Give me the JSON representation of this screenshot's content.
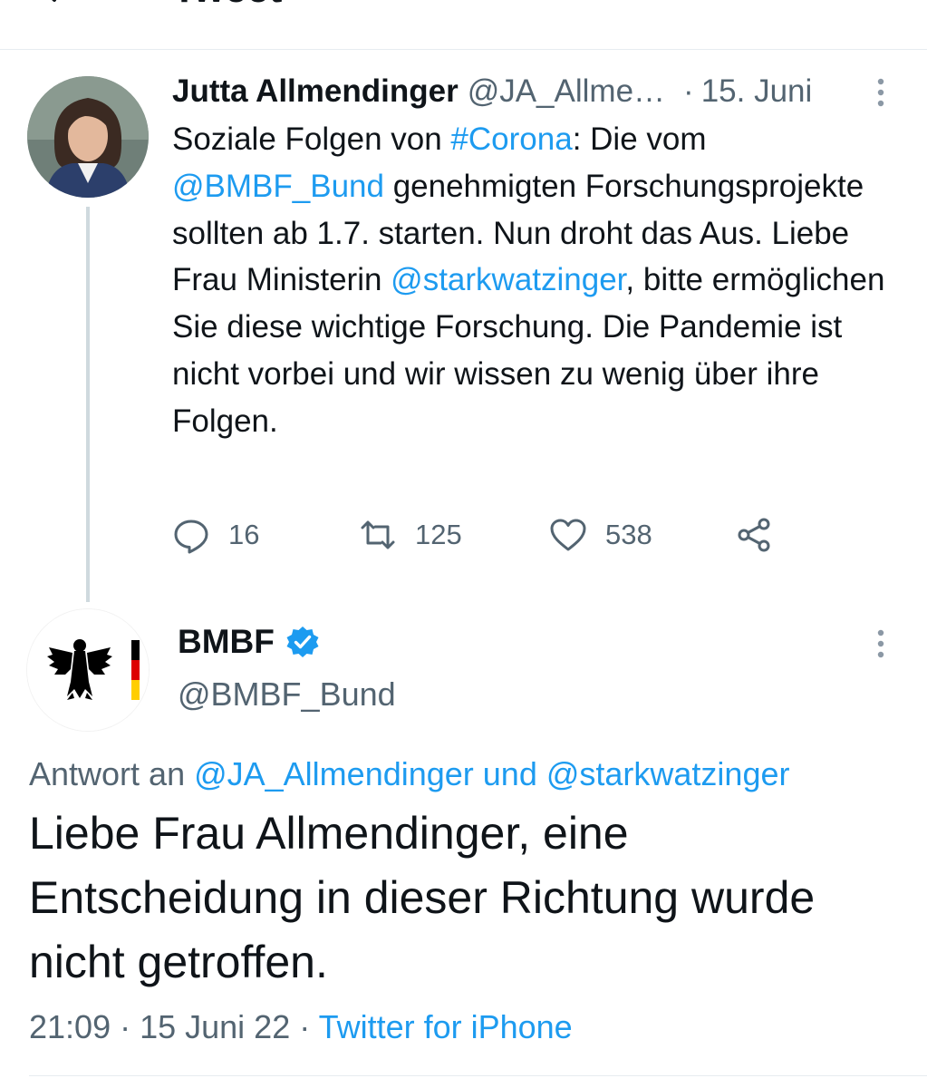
{
  "header": {
    "title": "Tweet"
  },
  "parent_tweet": {
    "author_name": "Jutta Allmendinger",
    "handle": "@JA_Allme…",
    "dot": "·",
    "date": "15. Juni",
    "text": {
      "t1": "Soziale Folgen von ",
      "hashtag": "#Corona",
      "t2": ": Die vom ",
      "mention1": "@BMBF_Bund",
      "t3": " genehmigten Forschungsprojekte sollten ab 1.7. starten. Nun droht das Aus. Liebe Frau Ministerin ",
      "mention2": "@starkwatzinger",
      "t4": ", bitte ermöglichen Sie diese wichtige Forschung. Die Pandemie ist nicht vorbei und wir wissen zu wenig über ihre Folgen."
    },
    "actions": {
      "replies": "16",
      "retweets": "125",
      "likes": "538"
    }
  },
  "main_tweet": {
    "author_name": "BMBF",
    "handle": "@BMBF_Bund",
    "reply_prefix": "Antwort an ",
    "reply_targets": "@JA_Allmendinger und @starkwatzinger",
    "text": "Liebe Frau Allmendinger, eine Entscheidung in dieser Richtung wurde nicht getroffen.",
    "time": "21:09",
    "sep1": " · ",
    "date": "15 Juni 22",
    "sep2": " · ",
    "source": "Twitter for iPhone"
  },
  "icons": {
    "back": "arrow-left-icon",
    "more": "vertical-dots-icon",
    "reply": "speech-bubble-icon",
    "retweet": "retweet-icon",
    "like": "heart-icon",
    "share": "share-icon",
    "verified": "verified-badge-icon"
  },
  "colors": {
    "accent": "#1d9bf0",
    "text": "#0f1419",
    "muted": "#536471",
    "flag_black": "#000000",
    "flag_red": "#dd0000",
    "flag_gold": "#ffce00"
  }
}
